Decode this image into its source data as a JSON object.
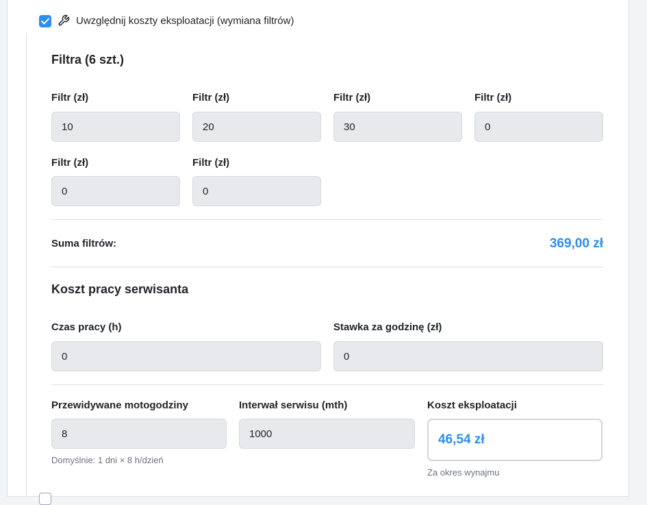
{
  "header": {
    "checkbox_label": "Uwzględnij koszty eksploatacji (wymiana filtrów)",
    "checked": true,
    "icon": "wrench-icon"
  },
  "filters": {
    "title": "Filtra (6 szt.)",
    "fields": [
      {
        "label": "Filtr (zł)",
        "value": "10"
      },
      {
        "label": "Filtr (zł)",
        "value": "20"
      },
      {
        "label": "Filtr (zł)",
        "value": "30"
      },
      {
        "label": "Filtr (zł)",
        "value": "0"
      },
      {
        "label": "Filtr (zł)",
        "value": "0"
      },
      {
        "label": "Filtr (zł)",
        "value": "0"
      }
    ],
    "sum_label": "Suma filtrów:",
    "sum_value": "369,00 zł"
  },
  "labor": {
    "title": "Koszt pracy serwisanta",
    "hours_label": "Czas pracy (h)",
    "hours_value": "0",
    "rate_label": "Stawka za godzinę (zł)",
    "rate_value": "0"
  },
  "summary": {
    "motohours_label": "Przewidywane motogodziny",
    "motohours_value": "8",
    "motohours_hint": "Domyślnie: 1 dni × 8 h/dzień",
    "interval_label": "Interwał serwisu (mth)",
    "interval_value": "1000",
    "cost_label": "Koszt eksploatacji",
    "cost_value": "46,54 zł",
    "cost_hint": "Za okres wynajmu"
  },
  "colors": {
    "accent": "#2b8ef0",
    "input_bg": "#e8e9ec",
    "border": "#dcdfe4"
  }
}
